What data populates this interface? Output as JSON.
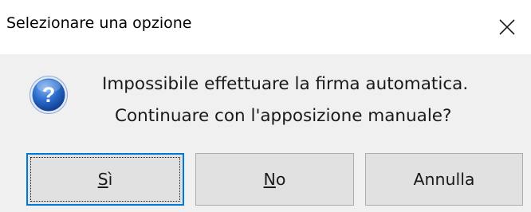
{
  "window": {
    "title": "Selezionare una opzione",
    "close_icon": "close-icon"
  },
  "message": {
    "icon": "question-icon",
    "line1": "Impossibile effettuare la firma automatica.",
    "line2": "Continuare con l'apposizione manuale?"
  },
  "buttons": {
    "yes": {
      "mnemonic": "S",
      "rest": "ì",
      "default": true
    },
    "no": {
      "mnemonic": "N",
      "rest": "o"
    },
    "cancel": {
      "label": "Annulla"
    }
  },
  "colors": {
    "titlebar_bg": "#ffffff",
    "dialog_bg": "#f0f0f0",
    "button_bg": "#e1e1e1",
    "default_button_border": "#0078d7",
    "icon_blue": "#1c5bb8"
  }
}
